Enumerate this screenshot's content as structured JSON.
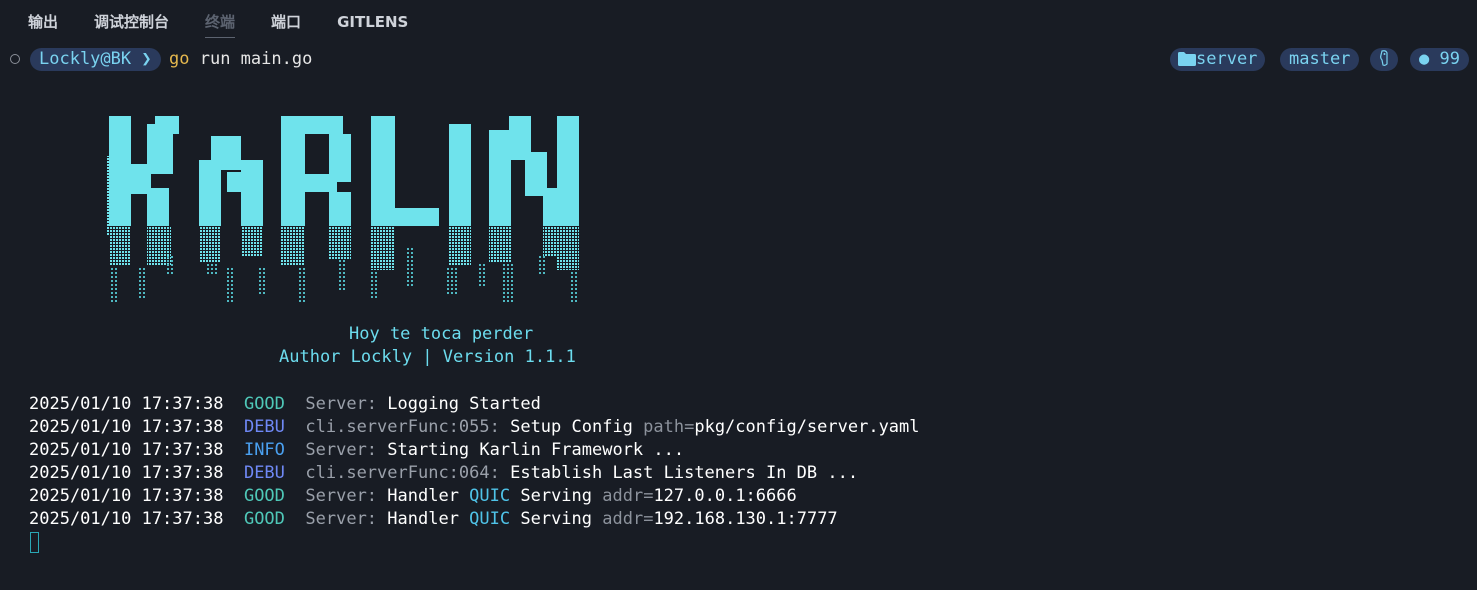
{
  "tabs": [
    {
      "label": "输出",
      "active": false
    },
    {
      "label": "调试控制台",
      "active": false
    },
    {
      "label": "终端",
      "active": true
    },
    {
      "label": "端口",
      "active": false
    },
    {
      "label": "GITLENS",
      "active": false
    }
  ],
  "prompt": {
    "user_host": "Lockly@BK ❯",
    "cmd_go": "go",
    "cmd_rest": " run main.go",
    "right": {
      "folder_icon": "folder-icon",
      "folder": "server",
      "branch": "master",
      "runtime_icon": "go-gopher-icon",
      "status_dot": "●",
      "status_count": "99"
    }
  },
  "banner": {
    "ascii_art_text": "KARLIN",
    "tagline": "Hoy te toca perder",
    "author_line": "Author Lockly | Version 1.1.1"
  },
  "logs": [
    {
      "ts": "2025/01/10 17:37:38",
      "level": "GOOD",
      "source": "Server:",
      "message": " Logging Started",
      "key": "",
      "hl": ""
    },
    {
      "ts": "2025/01/10 17:37:38",
      "level": "DEBU",
      "source": "cli.serverFunc:055:",
      "message": " Setup Config ",
      "key": "path=",
      "value": "pkg/config/server.yaml"
    },
    {
      "ts": "2025/01/10 17:37:38",
      "level": "INFO",
      "source": "Server:",
      "message": " Starting Karlin Framework ..."
    },
    {
      "ts": "2025/01/10 17:37:38",
      "level": "DEBU",
      "source": "cli.serverFunc:064:",
      "message": " Establish Last Listeners In DB ..."
    },
    {
      "ts": "2025/01/10 17:37:38",
      "level": "GOOD",
      "source": "Server:",
      "pre": " Handler ",
      "hl": "QUIC",
      "post": " Serving ",
      "key": "addr=",
      "value": "127.0.0.1:6666"
    },
    {
      "ts": "2025/01/10 17:37:38",
      "level": "GOOD",
      "source": "Server:",
      "pre": " Handler ",
      "hl": "QUIC",
      "post": " Serving ",
      "key": "addr=",
      "value": "192.168.130.1:7777"
    }
  ],
  "colors": {
    "background": "#181c24",
    "banner_cyan": "#6fe3ec",
    "good": "#4fc8b8",
    "debu": "#6f88f5",
    "info": "#4aa0f0"
  }
}
